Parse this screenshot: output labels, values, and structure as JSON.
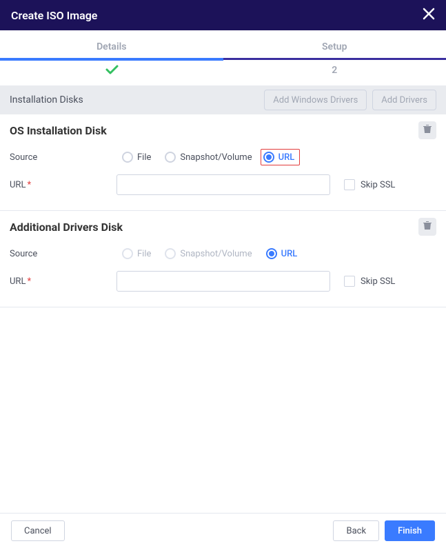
{
  "header": {
    "title": "Create ISO Image"
  },
  "wizard": {
    "step1": {
      "label": "Details",
      "indicator": "check"
    },
    "step2": {
      "label": "Setup",
      "indicator": "2"
    }
  },
  "sectionBar": {
    "title": "Installation Disks",
    "addWindowsDrivers": "Add Windows Drivers",
    "addDrivers": "Add Drivers"
  },
  "osDisk": {
    "title": "OS Installation Disk",
    "sourceLabel": "Source",
    "radioFile": "File",
    "radioSnapshot": "Snapshot/Volume",
    "radioUrl": "URL",
    "urlLabel": "URL",
    "urlValue": "",
    "skipSsl": "Skip SSL"
  },
  "driversDisk": {
    "title": "Additional Drivers Disk",
    "sourceLabel": "Source",
    "radioFile": "File",
    "radioSnapshot": "Snapshot/Volume",
    "radioUrl": "URL",
    "urlLabel": "URL",
    "urlValue": "",
    "skipSsl": "Skip SSL"
  },
  "footer": {
    "cancel": "Cancel",
    "back": "Back",
    "finish": "Finish"
  }
}
